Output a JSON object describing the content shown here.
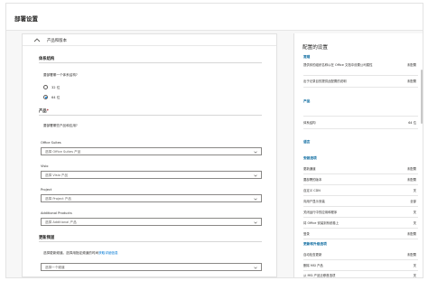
{
  "app": {
    "title": "部署设置"
  },
  "left_panel": {
    "section_title": "产品和版本",
    "architecture": {
      "heading": "体系结构",
      "question": "要部署哪一个体系结构?",
      "options": [
        {
          "label": "32 位",
          "selected": false
        },
        {
          "label": "64 位",
          "selected": true
        }
      ]
    },
    "products": {
      "heading": "产品",
      "required_mark": "*",
      "question": "要部署哪些产品和应用?",
      "fields": [
        {
          "label": "Office Suites",
          "placeholder": "选择 Office Suites 产品"
        },
        {
          "label": "Visio",
          "placeholder": "选择 Visio 产品"
        },
        {
          "label": "Project",
          "placeholder": "选择 Project 产品"
        },
        {
          "label": "Additional Products",
          "placeholder": "选择 Additional 产品"
        }
      ]
    },
    "update_channel": {
      "heading": "更新频道",
      "question_prefix": "选择更新频道。选择用指定频道的时间",
      "question_link": "获取详细信息",
      "placeholder": "选择一个频道"
    }
  },
  "right_panel": {
    "title": "配置的设置",
    "sections": [
      {
        "title": "常规",
        "rows": [
          {
            "key": "提供你的组织名称以在 Office 文档中设置公司属性",
            "value": "未配置"
          },
          {
            "key": "出于记录目的提供此配置的说明",
            "value": "未配置"
          }
        ]
      },
      {
        "title": "产品",
        "rows": [
          {
            "key": "",
            "value": ""
          },
          {
            "key": "体系结构",
            "value": "64 位"
          }
        ]
      },
      {
        "title": "语言",
        "rows": []
      },
      {
        "title": "安装选项",
        "rows": [
          {
            "key": "更新通道",
            "value": "未配置"
          },
          {
            "key": "要部署的版本",
            "value": "未配置"
          },
          {
            "key": "自定义 CDN",
            "value": "关"
          },
          {
            "key": "向用户显示安装",
            "value": "全部"
          },
          {
            "key": "关闭运行中的应用和程序",
            "value": "关"
          },
          {
            "key": "将 Office 安装到系统卷上",
            "value": "关"
          },
          {
            "key": "登录",
            "value": "未配置"
          }
        ]
      },
      {
        "title": "更新和升级选项",
        "rows": [
          {
            "key": "自动检查更新",
            "value": "未配置"
          },
          {
            "key": "删除 MSI 产品",
            "value": "关"
          },
          {
            "key": "从 MSI 产品迁移首选项",
            "value": "关"
          }
        ]
      }
    ]
  },
  "colors": {
    "accent": "#0078d4",
    "section_title": "#0b6a9f",
    "required": "#a4262c"
  },
  "icons": {
    "section_toggle": "chevron-up-icon",
    "select_caret": "chevron-down-icon"
  }
}
